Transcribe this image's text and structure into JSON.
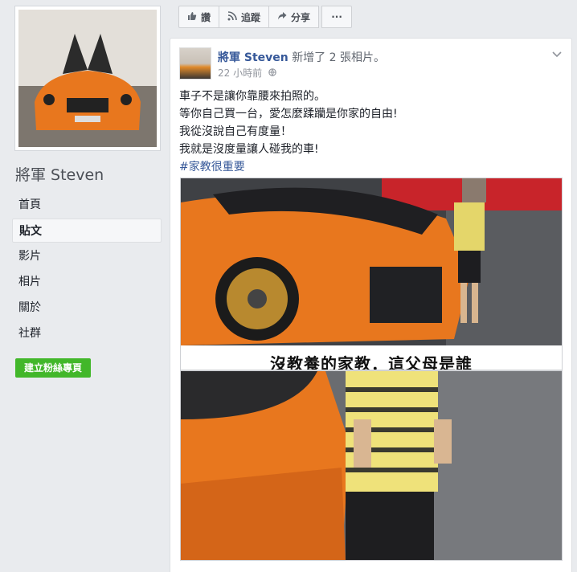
{
  "page": {
    "name": "將軍 Steven",
    "create_page_label": "建立粉絲專頁"
  },
  "sidebar": {
    "items": [
      {
        "label": "首頁"
      },
      {
        "label": "貼文"
      },
      {
        "label": "影片"
      },
      {
        "label": "相片"
      },
      {
        "label": "關於"
      },
      {
        "label": "社群"
      }
    ]
  },
  "action_bar": {
    "like_label": "讚",
    "follow_label": "追蹤",
    "share_label": "分享",
    "more_label": "···"
  },
  "post": {
    "author": "將軍 Steven",
    "action": "新增了 2 張相片。",
    "timestamp": "22 小時前",
    "text_lines": [
      "車子不是讓你靠腰來拍照的。",
      "等你自己買一台，愛怎麼蹂躪是你家的自由!",
      "我從沒說自己有度量！",
      "我就是沒度量讓人碰我的車!"
    ],
    "hashtag": "#家教很重要",
    "photo1_caption": "沒教養的家教．這父母是誰"
  },
  "icons": {
    "like": "thumbs-up-icon",
    "follow": "rss-icon",
    "share": "share-arrow-icon",
    "privacy": "globe-icon",
    "menu": "chevron-down-icon"
  },
  "colors": {
    "link": "#365899",
    "page_bg": "#e9ebee",
    "create_button": "#42b72a",
    "car_orange": "#e8771e"
  }
}
